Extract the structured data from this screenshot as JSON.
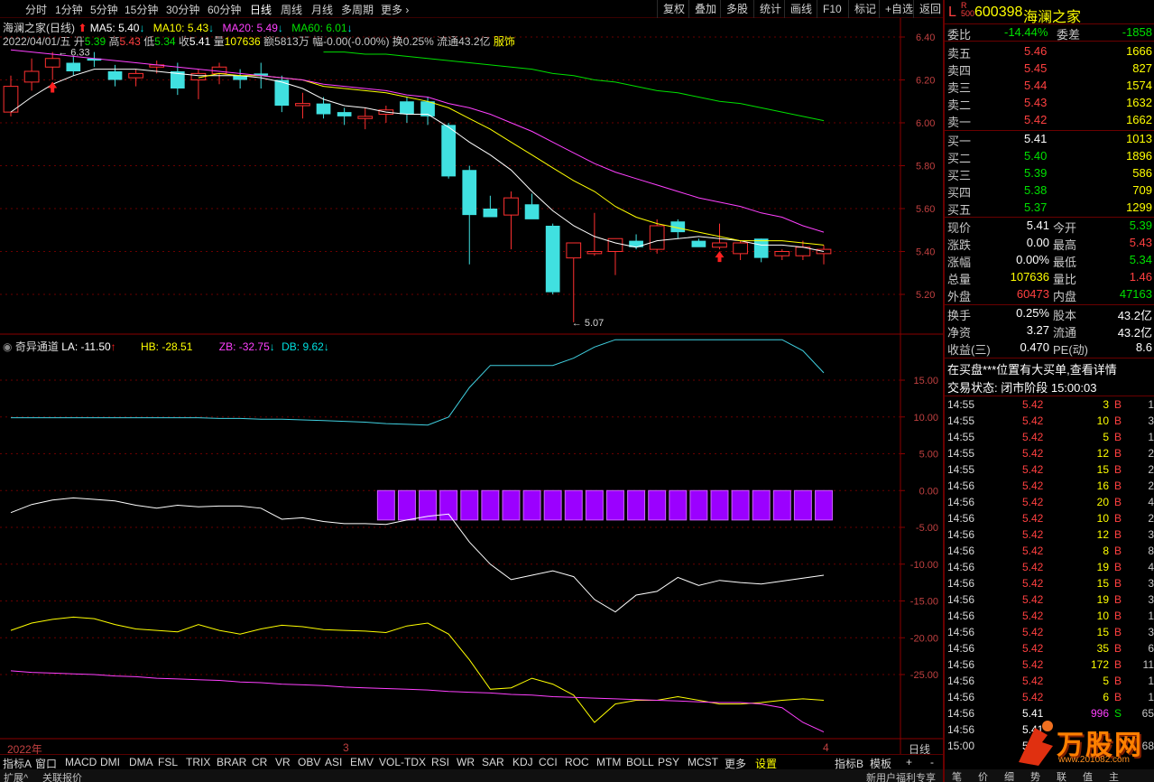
{
  "toolbar": {
    "periods": [
      "分时",
      "1分钟",
      "5分钟",
      "15分钟",
      "30分钟",
      "60分钟",
      "日线",
      "周线",
      "月线",
      "多周期",
      "更多"
    ],
    "active_period": "日线",
    "right_buttons": [
      "复权",
      "叠加",
      "多股",
      "统计",
      "画线",
      "F10",
      "标记",
      "+自选",
      "返回"
    ]
  },
  "stock_header": {
    "title": "海澜之家(日线)",
    "ma": [
      {
        "label": "MA5: 5.40",
        "color": "#ffffff"
      },
      {
        "label": "MA10: 5.43",
        "color": "#ffff00"
      },
      {
        "label": "MA20: 5.49",
        "color": "#ff40ff"
      },
      {
        "label": "MA60: 6.01",
        "color": "#00e000"
      }
    ],
    "date": "2022/04/01/五",
    "open_label": "开",
    "open": "5.39",
    "high_label": "高",
    "high": "5.43",
    "low_label": "低",
    "low": "5.34",
    "close_label": "收",
    "close": "5.41",
    "vol_label": "量",
    "vol": "107636",
    "amount": "额5813万",
    "change": "幅-0.00(-0.00%)",
    "turnover": "换0.25%",
    "float": "流通43.2亿",
    "industry": "服饰"
  },
  "price_axis": [
    "6.40",
    "6.20",
    "6.00",
    "5.80",
    "5.60",
    "5.40",
    "5.20"
  ],
  "price_annotations": {
    "high": "6.33",
    "low": "5.07"
  },
  "indicator_header": {
    "name": "奇异通道",
    "la": "LA: -11.50",
    "hb": "HB: -28.51",
    "zb": "ZB: -32.75",
    "db": "DB: 9.62"
  },
  "indicator_axis": [
    "15.00",
    "10.00",
    "5.00",
    "0.00",
    "-5.00",
    "-10.00",
    "-15.00",
    "-20.00",
    "-25.00"
  ],
  "time_axis": {
    "year": "2022年",
    "m3": "3",
    "m4": "4",
    "period": "日线"
  },
  "indicator_tabs": [
    "指标A",
    "窗口",
    "MACD",
    "DMI",
    "DMA",
    "FSL",
    "TRIX",
    "BRAR",
    "CR",
    "VR",
    "OBV",
    "ASI",
    "EMV",
    "VOL-TDX",
    "RSI",
    "WR",
    "SAR",
    "KDJ",
    "CCI",
    "ROC",
    "MTM",
    "BOLL",
    "PSY",
    "MCST",
    "更多",
    "设置"
  ],
  "indicator_tabs_right": [
    "指标B",
    "模板",
    "+",
    "-"
  ],
  "status_row": [
    "扩展^",
    "关联报价"
  ],
  "status_right": "新用户福利专享",
  "chart_data": {
    "type": "candlestick",
    "x": [
      "d1",
      "d2",
      "d3",
      "d4",
      "d5",
      "d6",
      "d7",
      "d8",
      "d9",
      "d10",
      "d11",
      "d12",
      "d13",
      "d14",
      "d15",
      "d16",
      "d17",
      "d18",
      "d19",
      "d20",
      "d21",
      "d22",
      "d23",
      "d24",
      "d25",
      "d26",
      "d27",
      "d28",
      "d29",
      "d30",
      "d31",
      "d32",
      "d33",
      "d34",
      "d35",
      "d36",
      "d37",
      "d38",
      "d39",
      "d40"
    ],
    "ohlc": [
      [
        6.05,
        6.22,
        6.03,
        6.17
      ],
      [
        6.19,
        6.3,
        6.15,
        6.24
      ],
      [
        6.26,
        6.33,
        6.2,
        6.3
      ],
      [
        6.28,
        6.31,
        6.22,
        6.24
      ],
      [
        6.3,
        6.33,
        6.26,
        6.29
      ],
      [
        6.24,
        6.27,
        6.17,
        6.2
      ],
      [
        6.21,
        6.25,
        6.17,
        6.23
      ],
      [
        6.26,
        6.29,
        6.23,
        6.27
      ],
      [
        6.24,
        6.28,
        6.13,
        6.16
      ],
      [
        6.2,
        6.25,
        6.11,
        6.23
      ],
      [
        6.23,
        6.28,
        6.18,
        6.26
      ],
      [
        6.22,
        6.25,
        6.16,
        6.2
      ],
      [
        6.23,
        6.28,
        6.16,
        6.22
      ],
      [
        6.2,
        6.22,
        6.05,
        6.08
      ],
      [
        6.08,
        6.14,
        6.02,
        6.09
      ],
      [
        6.09,
        6.12,
        6.02,
        6.04
      ],
      [
        6.05,
        6.07,
        5.99,
        6.03
      ],
      [
        6.02,
        6.07,
        5.97,
        6.03
      ],
      [
        6.04,
        6.08,
        6.0,
        6.06
      ],
      [
        6.1,
        6.12,
        6.0,
        6.04
      ],
      [
        6.1,
        6.12,
        5.99,
        6.03
      ],
      [
        5.99,
        6.0,
        5.74,
        5.75
      ],
      [
        5.78,
        5.8,
        5.34,
        5.57
      ],
      [
        5.6,
        5.66,
        5.57,
        5.56
      ],
      [
        5.57,
        5.68,
        5.41,
        5.65
      ],
      [
        5.62,
        5.67,
        5.56,
        5.55
      ],
      [
        5.52,
        5.53,
        5.2,
        5.21
      ],
      [
        5.37,
        5.43,
        5.07,
        5.44
      ],
      [
        5.39,
        5.58,
        5.38,
        5.4
      ],
      [
        5.4,
        5.46,
        5.29,
        5.46
      ],
      [
        5.45,
        5.48,
        5.41,
        5.42
      ],
      [
        5.41,
        5.55,
        5.39,
        5.52
      ],
      [
        5.54,
        5.55,
        5.46,
        5.49
      ],
      [
        5.45,
        5.46,
        5.43,
        5.42
      ],
      [
        5.42,
        5.53,
        5.41,
        5.44
      ],
      [
        5.39,
        5.45,
        5.36,
        5.44
      ],
      [
        5.46,
        5.46,
        5.35,
        5.37
      ],
      [
        5.38,
        5.41,
        5.36,
        5.4
      ],
      [
        5.38,
        5.45,
        5.36,
        5.42
      ],
      [
        5.39,
        5.43,
        5.34,
        5.41
      ]
    ],
    "series": [
      {
        "name": "MA5",
        "color": "#ffffff",
        "values": [
          6.05,
          6.12,
          6.18,
          6.22,
          6.25,
          6.25,
          6.25,
          6.24,
          6.23,
          6.22,
          6.22,
          6.22,
          6.21,
          6.19,
          6.16,
          6.11,
          6.08,
          6.07,
          6.05,
          6.04,
          6.04,
          5.98,
          5.91,
          5.85,
          5.78,
          5.68,
          5.59,
          5.52,
          5.47,
          5.44,
          5.42,
          5.45,
          5.46,
          5.47,
          5.46,
          5.45,
          5.43,
          5.43,
          5.42,
          5.4
        ]
      },
      {
        "name": "MA10",
        "color": "#ffff00",
        "values": [
          null,
          null,
          null,
          null,
          null,
          null,
          null,
          null,
          null,
          6.21,
          6.23,
          6.22,
          6.22,
          6.21,
          6.2,
          6.17,
          6.16,
          6.15,
          6.14,
          6.12,
          6.1,
          6.07,
          6.02,
          5.97,
          5.91,
          5.85,
          5.79,
          5.73,
          5.68,
          5.61,
          5.56,
          5.53,
          5.51,
          5.49,
          5.47,
          5.45,
          5.45,
          5.45,
          5.44,
          5.43
        ]
      },
      {
        "name": "MA20",
        "color": "#ff40ff",
        "values": [
          6.34,
          6.33,
          6.32,
          6.31,
          6.3,
          6.29,
          6.28,
          6.27,
          6.26,
          6.25,
          6.24,
          6.23,
          6.22,
          6.21,
          6.2,
          6.18,
          6.17,
          6.16,
          6.15,
          6.13,
          6.12,
          6.09,
          6.07,
          6.04,
          6.0,
          5.96,
          5.91,
          5.86,
          5.81,
          5.77,
          5.74,
          5.71,
          5.68,
          5.65,
          5.63,
          5.61,
          5.58,
          5.56,
          5.52,
          5.49
        ]
      },
      {
        "name": "MA60",
        "color": "#00e000",
        "values": [
          null,
          null,
          null,
          null,
          null,
          null,
          null,
          null,
          null,
          null,
          null,
          null,
          null,
          null,
          null,
          6.33,
          6.33,
          6.32,
          6.32,
          6.31,
          6.3,
          6.29,
          6.28,
          6.27,
          6.26,
          6.25,
          6.23,
          6.22,
          6.2,
          6.19,
          6.17,
          6.15,
          6.14,
          6.12,
          6.1,
          6.09,
          6.07,
          6.05,
          6.03,
          6.01
        ]
      }
    ],
    "indicator": {
      "DB": [
        9.9,
        9.9,
        9.9,
        9.9,
        9.9,
        9.9,
        9.9,
        9.9,
        9.9,
        9.9,
        9.8,
        9.8,
        9.7,
        9.7,
        9.6,
        9.5,
        9.4,
        9.3,
        9.1,
        9.0,
        8.9,
        10.0,
        14.0,
        17.0,
        17.0,
        17.0,
        17.0,
        18.0,
        19.5,
        20.5,
        20.5,
        20.5,
        20.5,
        20.5,
        20.5,
        20.5,
        20.5,
        20.5,
        19.0,
        16.0
      ],
      "LA": [
        -3.0,
        -1.9,
        -1.3,
        -1.0,
        -1.2,
        -1.4,
        -2.0,
        -2.4,
        -2.0,
        -2.2,
        -2.1,
        -2.1,
        -2.4,
        -3.9,
        -3.7,
        -4.2,
        -4.5,
        -4.5,
        -4.6,
        -4.0,
        -3.5,
        -3.2,
        -7.0,
        -10.0,
        -12.1,
        -11.5,
        -10.9,
        -11.7,
        -14.8,
        -16.5,
        -14.2,
        -13.7,
        -11.8,
        -12.9,
        -12.2,
        -12.5,
        -12.7,
        -12.3,
        -11.9,
        -11.5
      ],
      "HB": [
        -19.0,
        -18.0,
        -17.5,
        -17.2,
        -17.4,
        -18.2,
        -18.8,
        -19.0,
        -19.2,
        -18.2,
        -19.0,
        -19.5,
        -18.8,
        -18.3,
        -18.5,
        -18.9,
        -19.0,
        -19.1,
        -19.3,
        -18.4,
        -18.0,
        -19.5,
        -23.0,
        -27.0,
        -26.8,
        -25.5,
        -26.3,
        -27.8,
        -31.5,
        -29.0,
        -28.5,
        -28.5,
        -28.0,
        -28.5,
        -29.0,
        -29.0,
        -28.8,
        -28.5,
        -28.3,
        -28.5
      ],
      "ZB": [
        -24.5,
        -24.7,
        -24.8,
        -24.9,
        -25.0,
        -25.2,
        -25.3,
        -25.5,
        -25.6,
        -25.7,
        -25.8,
        -26.0,
        -26.1,
        -26.3,
        -26.4,
        -26.5,
        -26.7,
        -26.8,
        -26.9,
        -27.0,
        -27.1,
        -27.3,
        -27.4,
        -27.5,
        -27.7,
        -27.8,
        -28.0,
        -28.1,
        -28.2,
        -28.3,
        -28.4,
        -28.5,
        -28.6,
        -28.7,
        -28.8,
        -28.8,
        -29.0,
        -29.5,
        -31.5,
        -32.8
      ],
      "bars_from": 18
    }
  },
  "right_panel": {
    "flag": "L",
    "code": "600398",
    "name": "海澜之家",
    "weibi_label": "委比",
    "weibi": "-14.44%",
    "weicha_label": "委差",
    "weicha": "-1858",
    "asks": [
      {
        "label": "卖五",
        "price": "5.46",
        "vol": "1666"
      },
      {
        "label": "卖四",
        "price": "5.45",
        "vol": "827"
      },
      {
        "label": "卖三",
        "price": "5.44",
        "vol": "1574"
      },
      {
        "label": "卖二",
        "price": "5.43",
        "vol": "1632"
      },
      {
        "label": "卖一",
        "price": "5.42",
        "vol": "1662"
      }
    ],
    "bids": [
      {
        "label": "买一",
        "price": "5.41",
        "vol": "1013",
        "pcolor": "#ffffff"
      },
      {
        "label": "买二",
        "price": "5.40",
        "vol": "1896",
        "pcolor": "#00e000"
      },
      {
        "label": "买三",
        "price": "5.39",
        "vol": "586",
        "pcolor": "#00e000"
      },
      {
        "label": "买四",
        "price": "5.38",
        "vol": "709",
        "pcolor": "#00e000"
      },
      {
        "label": "买五",
        "price": "5.37",
        "vol": "1299",
        "pcolor": "#00e000"
      }
    ],
    "stats": [
      {
        "l1": "现价",
        "v1": "5.41",
        "c1": "#ffffff",
        "l2": "今开",
        "v2": "5.39",
        "c2": "#00e000"
      },
      {
        "l1": "涨跌",
        "v1": "0.00",
        "c1": "#ffffff",
        "l2": "最高",
        "v2": "5.43",
        "c2": "#ff4040"
      },
      {
        "l1": "涨幅",
        "v1": "0.00%",
        "c1": "#ffffff",
        "l2": "最低",
        "v2": "5.34",
        "c2": "#00e000"
      },
      {
        "l1": "总量",
        "v1": "107636",
        "c1": "#ffff00",
        "l2": "量比",
        "v2": "1.46",
        "c2": "#ff4040"
      },
      {
        "l1": "外盘",
        "v1": "60473",
        "c1": "#ff4040",
        "l2": "内盘",
        "v2": "47163",
        "c2": "#00e000"
      }
    ],
    "fund": [
      {
        "l1": "换手",
        "v1": "0.25%",
        "l2": "股本",
        "v2": "43.2亿"
      },
      {
        "l1": "净资",
        "v1": "3.27",
        "l2": "流通",
        "v2": "43.2亿"
      },
      {
        "l1": "收益(三)",
        "v1": "0.470",
        "l2": "PE(动)",
        "v2": "8.6"
      }
    ],
    "notice": "在买盘***位置有大买单,查看详情",
    "trade_status": "交易状态: 闭市阶段 15:00:03",
    "ticks": [
      {
        "t": "14:55",
        "p": "5.42",
        "v": "3",
        "s": "B",
        "n": "1"
      },
      {
        "t": "14:55",
        "p": "5.42",
        "v": "10",
        "s": "B",
        "n": "3"
      },
      {
        "t": "14:55",
        "p": "5.42",
        "v": "5",
        "s": "B",
        "n": "1"
      },
      {
        "t": "14:55",
        "p": "5.42",
        "v": "12",
        "s": "B",
        "n": "2"
      },
      {
        "t": "14:55",
        "p": "5.42",
        "v": "15",
        "s": "B",
        "n": "2"
      },
      {
        "t": "14:56",
        "p": "5.42",
        "v": "16",
        "s": "B",
        "n": "2"
      },
      {
        "t": "14:56",
        "p": "5.42",
        "v": "20",
        "s": "B",
        "n": "4"
      },
      {
        "t": "14:56",
        "p": "5.42",
        "v": "10",
        "s": "B",
        "n": "2"
      },
      {
        "t": "14:56",
        "p": "5.42",
        "v": "12",
        "s": "B",
        "n": "3"
      },
      {
        "t": "14:56",
        "p": "5.42",
        "v": "8",
        "s": "B",
        "n": "8"
      },
      {
        "t": "14:56",
        "p": "5.42",
        "v": "19",
        "s": "B",
        "n": "4"
      },
      {
        "t": "14:56",
        "p": "5.42",
        "v": "15",
        "s": "B",
        "n": "3"
      },
      {
        "t": "14:56",
        "p": "5.42",
        "v": "19",
        "s": "B",
        "n": "3"
      },
      {
        "t": "14:56",
        "p": "5.42",
        "v": "10",
        "s": "B",
        "n": "1"
      },
      {
        "t": "14:56",
        "p": "5.42",
        "v": "15",
        "s": "B",
        "n": "3"
      },
      {
        "t": "14:56",
        "p": "5.42",
        "v": "35",
        "s": "B",
        "n": "6"
      },
      {
        "t": "14:56",
        "p": "5.42",
        "v": "172",
        "s": "B",
        "n": "11"
      },
      {
        "t": "14:56",
        "p": "5.42",
        "v": "5",
        "s": "B",
        "n": "1"
      },
      {
        "t": "14:56",
        "p": "5.42",
        "v": "6",
        "s": "B",
        "n": "1"
      },
      {
        "t": "14:56",
        "p": "5.41",
        "v": "996",
        "s": "S",
        "n": "65"
      },
      {
        "t": "14:56",
        "p": "5.41",
        "v": "",
        "s": "",
        "n": ""
      },
      {
        "t": "15:00",
        "p": "5.41",
        "v": "",
        "s": "",
        "n": "68"
      }
    ],
    "bottom_tabs": [
      "笔",
      "价",
      "细",
      "势",
      "联",
      "值",
      "主"
    ],
    "watermark": "万股网",
    "watermark_url": "www.201082.com"
  }
}
